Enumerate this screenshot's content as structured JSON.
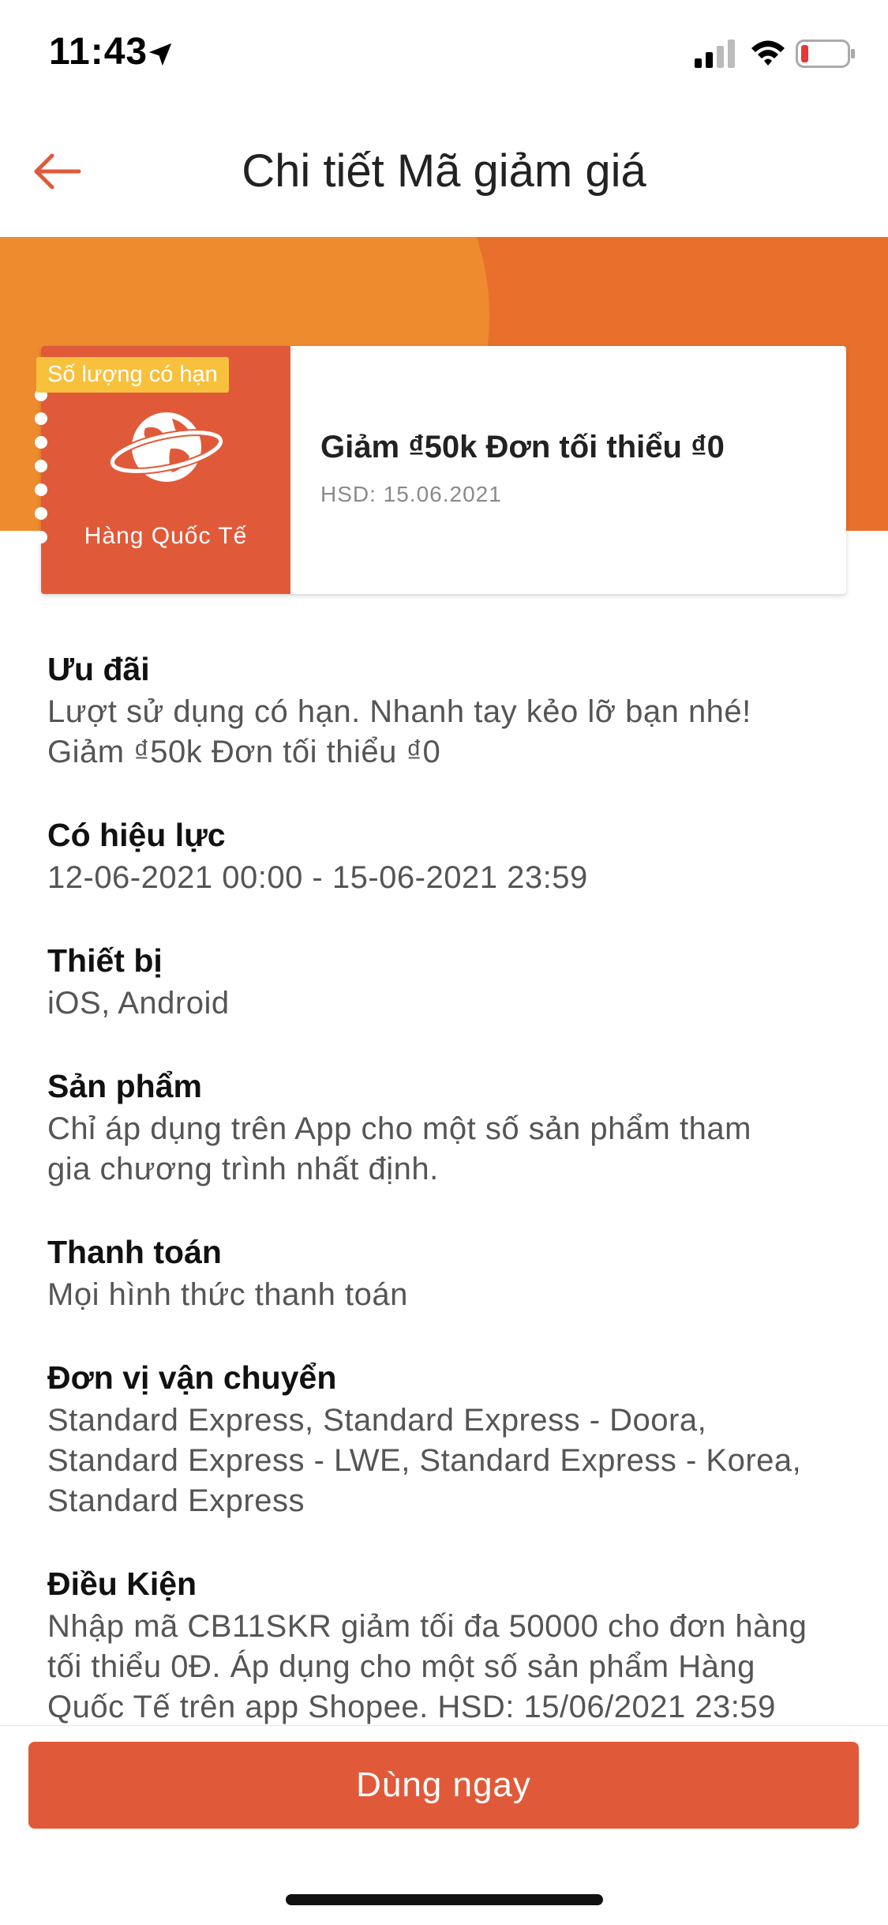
{
  "status_bar": {
    "time": "11:43",
    "icons": [
      "location-arrow-icon",
      "signal-icon",
      "wifi-icon",
      "battery-low-icon"
    ]
  },
  "header": {
    "title": "Chi tiết Mã giảm giá",
    "back_icon": "arrow-left-icon"
  },
  "colors": {
    "accent": "#e05a3a",
    "banner": "#e8702c",
    "banner_light": "#ef8b2f",
    "badge": "#f7c13d"
  },
  "voucher": {
    "badge": "Số lượng có hạn",
    "category": "Hàng Quốc Tế",
    "icon": "globe-icon",
    "title": "Giảm ₫50k Đơn tối thiểu ₫0",
    "expiry": "HSD: 15.06.2021"
  },
  "sections": [
    {
      "heading": "Ưu đãi",
      "lines": [
        "Lượt sử dụng có hạn. Nhanh tay kẻo lỡ bạn nhé!",
        "Giảm ₫50k Đơn tối thiểu ₫0"
      ]
    },
    {
      "heading": "Có hiệu lực",
      "lines": [
        "12-06-2021 00:00 - 15-06-2021 23:59"
      ]
    },
    {
      "heading": "Thiết bị",
      "lines": [
        "iOS, Android"
      ]
    },
    {
      "heading": "Sản phẩm",
      "lines": [
        "Chỉ áp dụng trên App cho một số sản phẩm tham",
        "gia chương trình nhất định."
      ]
    },
    {
      "heading": "Thanh toán",
      "lines": [
        "Mọi hình thức thanh toán"
      ]
    },
    {
      "heading": "Đơn vị vận chuyển",
      "lines": [
        "Standard Express, Standard Express - Doora,",
        "Standard Express - LWE, Standard Express - Korea,",
        "Standard Express"
      ]
    },
    {
      "heading": "Điều Kiện",
      "lines": [
        "Nhập mã CB11SKR giảm tối đa 50000 cho đơn hàng",
        "tối thiểu 0Đ. Áp dụng cho một số sản phẩm Hàng",
        "Quốc Tế trên app Shopee. HSD: 15/06/2021 23:59"
      ]
    }
  ],
  "footer": {
    "button_label": "Dùng ngay"
  }
}
